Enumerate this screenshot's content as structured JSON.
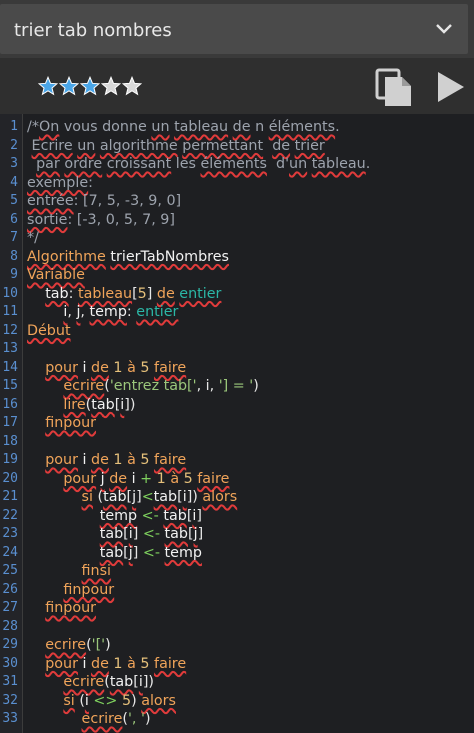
{
  "header": {
    "title": "trier tab nombres"
  },
  "rating": {
    "filled": 3,
    "total": 5,
    "accent": "#4aa6e8"
  },
  "editor": {
    "lines": [
      {
        "n": "1",
        "t": [
          [
            "cm",
            "/*"
          ],
          [
            "cm err",
            "On"
          ],
          [
            "cm",
            " vous donne "
          ],
          [
            "cm err",
            "un"
          ],
          [
            "cm",
            " "
          ],
          [
            "cm err",
            "tableau"
          ],
          [
            "cm",
            " "
          ],
          [
            "cm err",
            "de"
          ],
          [
            "cm",
            " n "
          ],
          [
            "cm err",
            "éléments"
          ],
          [
            "cm",
            "."
          ]
        ]
      },
      {
        "n": "2",
        "t": [
          [
            "cm",
            " "
          ],
          [
            "cm err",
            "Ecrire"
          ],
          [
            "cm",
            " "
          ],
          [
            "cm err",
            "un"
          ],
          [
            "cm",
            " "
          ],
          [
            "cm err",
            "algorithme"
          ],
          [
            "cm",
            " "
          ],
          [
            "cm err",
            "permettant"
          ],
          [
            "cm",
            "  "
          ],
          [
            "cm err",
            "de"
          ],
          [
            "cm",
            " "
          ],
          [
            "cm err",
            "trier"
          ]
        ]
      },
      {
        "n": "3",
        "t": [
          [
            "cm",
            "  "
          ],
          [
            "cm err",
            "par"
          ],
          [
            "cm",
            " "
          ],
          [
            "cm err",
            "ordre"
          ],
          [
            "cm",
            " "
          ],
          [
            "cm err",
            "croissant"
          ],
          [
            "cm",
            " les "
          ],
          [
            "cm err",
            "éléments"
          ],
          [
            "cm",
            "  d'"
          ],
          [
            "cm err",
            "un"
          ],
          [
            "cm",
            " "
          ],
          [
            "cm err",
            "tableau"
          ],
          [
            "cm",
            "."
          ]
        ]
      },
      {
        "n": "4",
        "t": [
          [
            "cm err",
            "exemple"
          ],
          [
            "cm",
            ":"
          ]
        ]
      },
      {
        "n": "5",
        "t": [
          [
            "cm err",
            "entrée"
          ],
          [
            "cm",
            ": [7, 5, -3, 9, 0]"
          ]
        ]
      },
      {
        "n": "6",
        "t": [
          [
            "cm err",
            "sortie"
          ],
          [
            "cm",
            ": [-3, 0, 5, 7, 9]"
          ]
        ]
      },
      {
        "n": "7",
        "t": [
          [
            "cm",
            "*/"
          ]
        ]
      },
      {
        "n": "8",
        "t": [
          [
            "kw err",
            "Algorithme"
          ],
          [
            "var",
            " "
          ],
          [
            "var err",
            "trierTabNombres"
          ]
        ]
      },
      {
        "n": "9",
        "t": [
          [
            "kw err",
            "Variable"
          ]
        ]
      },
      {
        "n": "10",
        "t": [
          [
            "var",
            "    "
          ],
          [
            "var err",
            "tab"
          ],
          [
            "pun",
            ": "
          ],
          [
            "kw err",
            "tableau"
          ],
          [
            "pun",
            "["
          ],
          [
            "num",
            "5"
          ],
          [
            "pun",
            "] "
          ],
          [
            "kw err",
            "de"
          ],
          [
            "pun",
            " "
          ],
          [
            "ty err",
            "entier"
          ]
        ]
      },
      {
        "n": "11",
        "t": [
          [
            "var",
            "        "
          ],
          [
            "var err",
            "i"
          ],
          [
            "pun",
            ", "
          ],
          [
            "var err",
            "j"
          ],
          [
            "pun",
            ", "
          ],
          [
            "var err",
            "temp"
          ],
          [
            "pun",
            ": "
          ],
          [
            "ty err",
            "entier"
          ]
        ]
      },
      {
        "n": "12",
        "t": [
          [
            "kw err",
            "Début"
          ]
        ]
      },
      {
        "n": "13",
        "t": []
      },
      {
        "n": "14",
        "t": [
          [
            "var",
            "    "
          ],
          [
            "kw err",
            "pour"
          ],
          [
            "var",
            " i "
          ],
          [
            "kw err",
            "de"
          ],
          [
            "num",
            " 1 "
          ],
          [
            "kw",
            "à"
          ],
          [
            "num",
            " 5 "
          ],
          [
            "kw err",
            "faire"
          ]
        ]
      },
      {
        "n": "15",
        "t": [
          [
            "var",
            "        "
          ],
          [
            "kw err",
            "ecrire"
          ],
          [
            "pun",
            "("
          ],
          [
            "str",
            "'entrez tab['"
          ],
          [
            "pun",
            ", i, "
          ],
          [
            "str",
            "'] = '"
          ],
          [
            "pun",
            ")"
          ]
        ]
      },
      {
        "n": "16",
        "t": [
          [
            "var",
            "        "
          ],
          [
            "kw err",
            "lire"
          ],
          [
            "pun",
            "("
          ],
          [
            "var err",
            "tab"
          ],
          [
            "pun",
            "["
          ],
          [
            "var err",
            "i"
          ],
          [
            "pun",
            "])"
          ]
        ]
      },
      {
        "n": "17",
        "t": [
          [
            "var",
            "    "
          ],
          [
            "kw err",
            "finpour"
          ]
        ]
      },
      {
        "n": "18",
        "t": []
      },
      {
        "n": "19",
        "t": [
          [
            "var",
            "    "
          ],
          [
            "kw err",
            "pour"
          ],
          [
            "var",
            " i "
          ],
          [
            "kw err",
            "de"
          ],
          [
            "num",
            " 1 "
          ],
          [
            "kw",
            "à"
          ],
          [
            "num",
            " 5 "
          ],
          [
            "kw err",
            "faire"
          ]
        ]
      },
      {
        "n": "20",
        "t": [
          [
            "var",
            "        "
          ],
          [
            "kw err",
            "pour"
          ],
          [
            "var",
            " "
          ],
          [
            "var err",
            "j"
          ],
          [
            "var",
            " "
          ],
          [
            "kw err",
            "de"
          ],
          [
            "var",
            " i "
          ],
          [
            "op",
            "+"
          ],
          [
            "num",
            " 1 "
          ],
          [
            "kw",
            "à"
          ],
          [
            "num",
            " 5 "
          ],
          [
            "kw err",
            "faire"
          ]
        ]
      },
      {
        "n": "21",
        "t": [
          [
            "var",
            "            "
          ],
          [
            "kw err",
            "si"
          ],
          [
            "pun",
            " ("
          ],
          [
            "var err",
            "tab"
          ],
          [
            "pun",
            "["
          ],
          [
            "var err",
            "j"
          ],
          [
            "pun",
            "]"
          ],
          [
            "op",
            "<"
          ],
          [
            "var err",
            "tab"
          ],
          [
            "pun",
            "["
          ],
          [
            "var err",
            "i"
          ],
          [
            "pun",
            "]) "
          ],
          [
            "kw err",
            "alors"
          ]
        ]
      },
      {
        "n": "22",
        "t": [
          [
            "var",
            "                "
          ],
          [
            "var err",
            "temp"
          ],
          [
            "op",
            " <- "
          ],
          [
            "var err",
            "tab"
          ],
          [
            "pun",
            "["
          ],
          [
            "var err",
            "i"
          ],
          [
            "pun",
            "]"
          ]
        ]
      },
      {
        "n": "23",
        "t": [
          [
            "var",
            "                "
          ],
          [
            "var err",
            "tab"
          ],
          [
            "pun",
            "["
          ],
          [
            "var err",
            "i"
          ],
          [
            "pun",
            "]"
          ],
          [
            "op",
            " <- "
          ],
          [
            "var err",
            "tab"
          ],
          [
            "pun",
            "["
          ],
          [
            "var err",
            "j"
          ],
          [
            "pun",
            "]"
          ]
        ]
      },
      {
        "n": "24",
        "t": [
          [
            "var",
            "                "
          ],
          [
            "var err",
            "tab"
          ],
          [
            "pun",
            "["
          ],
          [
            "var err",
            "j"
          ],
          [
            "pun",
            "]"
          ],
          [
            "op",
            " <- "
          ],
          [
            "var err",
            "temp"
          ]
        ]
      },
      {
        "n": "25",
        "t": [
          [
            "var",
            "            "
          ],
          [
            "kw err",
            "finsi"
          ]
        ]
      },
      {
        "n": "26",
        "t": [
          [
            "var",
            "        "
          ],
          [
            "kw err",
            "finpour"
          ]
        ]
      },
      {
        "n": "27",
        "t": [
          [
            "var",
            "    "
          ],
          [
            "kw err",
            "finpour"
          ]
        ]
      },
      {
        "n": "28",
        "t": []
      },
      {
        "n": "29",
        "t": [
          [
            "var",
            "    "
          ],
          [
            "kw err",
            "ecrire"
          ],
          [
            "pun",
            "("
          ],
          [
            "str",
            "'['"
          ],
          [
            "pun",
            ")"
          ]
        ]
      },
      {
        "n": "30",
        "t": [
          [
            "var",
            "    "
          ],
          [
            "kw err",
            "pour"
          ],
          [
            "var",
            " i "
          ],
          [
            "kw err",
            "de"
          ],
          [
            "num",
            " 1 "
          ],
          [
            "kw",
            "à"
          ],
          [
            "num",
            " 5 "
          ],
          [
            "kw err",
            "faire"
          ]
        ]
      },
      {
        "n": "31",
        "t": [
          [
            "var",
            "        "
          ],
          [
            "kw err",
            "ecrire"
          ],
          [
            "pun",
            "("
          ],
          [
            "var err",
            "tab"
          ],
          [
            "pun",
            "["
          ],
          [
            "var err",
            "i"
          ],
          [
            "pun",
            "])"
          ]
        ]
      },
      {
        "n": "32",
        "t": [
          [
            "var",
            "        "
          ],
          [
            "kw err",
            "si"
          ],
          [
            "pun",
            " ("
          ],
          [
            "var err",
            "i"
          ],
          [
            "op",
            " <> "
          ],
          [
            "num",
            "5"
          ],
          [
            "pun",
            ") "
          ],
          [
            "kw err",
            "alors"
          ]
        ]
      },
      {
        "n": "33",
        "t": [
          [
            "var",
            "            "
          ],
          [
            "kw err",
            "ecrire"
          ],
          [
            "pun",
            "("
          ],
          [
            "str",
            "', '"
          ],
          [
            "pun",
            ")"
          ]
        ]
      }
    ]
  }
}
